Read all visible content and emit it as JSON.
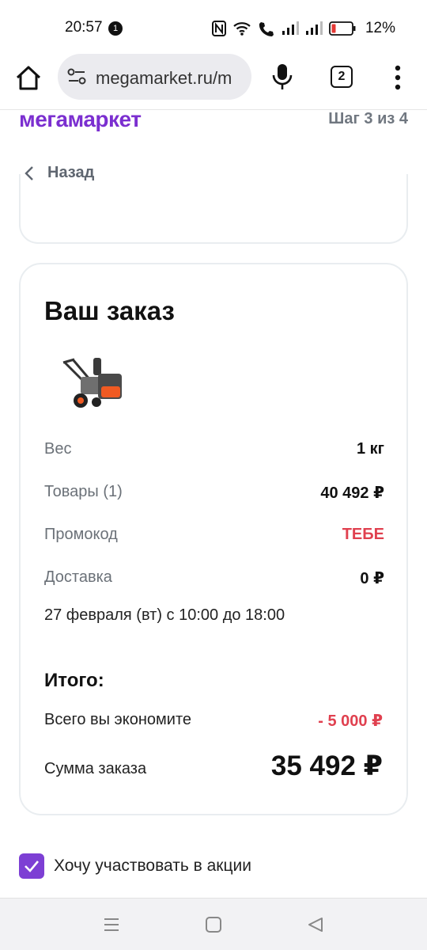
{
  "status_bar": {
    "time": "20:57",
    "notification_count": "1",
    "battery_percent": "12%",
    "battery_color": "#e53935"
  },
  "browser": {
    "url": "megamarket.ru/m",
    "tab_count": "2"
  },
  "header": {
    "logo_text": "мегамаркет",
    "step_text": "Шаг 3 из 4",
    "brand_color": "#7b2fd0"
  },
  "back": {
    "label": "Назад"
  },
  "order": {
    "title": "Ваш заказ",
    "product_image": "snowblower-image",
    "rows": [
      {
        "label": "Вес",
        "value": "1 кг"
      },
      {
        "label": "Товары (1)",
        "value": "40 492 ₽"
      },
      {
        "label": "Промокод",
        "value": "ТЕБЕ"
      },
      {
        "label": "Доставка",
        "value": "0 ₽"
      }
    ],
    "delivery_date": "27 февраля (вт) с 10:00 до 18:00",
    "total_title": "Итого:",
    "savings_label": "Всего вы экономите",
    "savings_value": "- 5 000 ₽",
    "sum_label": "Сумма заказа",
    "sum_value": "35 492 ₽",
    "accent_red": "#e0404f"
  },
  "promo_checkbox": {
    "label": "Хочу участвовать в акции",
    "checked": true
  },
  "nav": {
    "icons": [
      "recent-apps-icon",
      "home-icon",
      "back-icon"
    ]
  }
}
